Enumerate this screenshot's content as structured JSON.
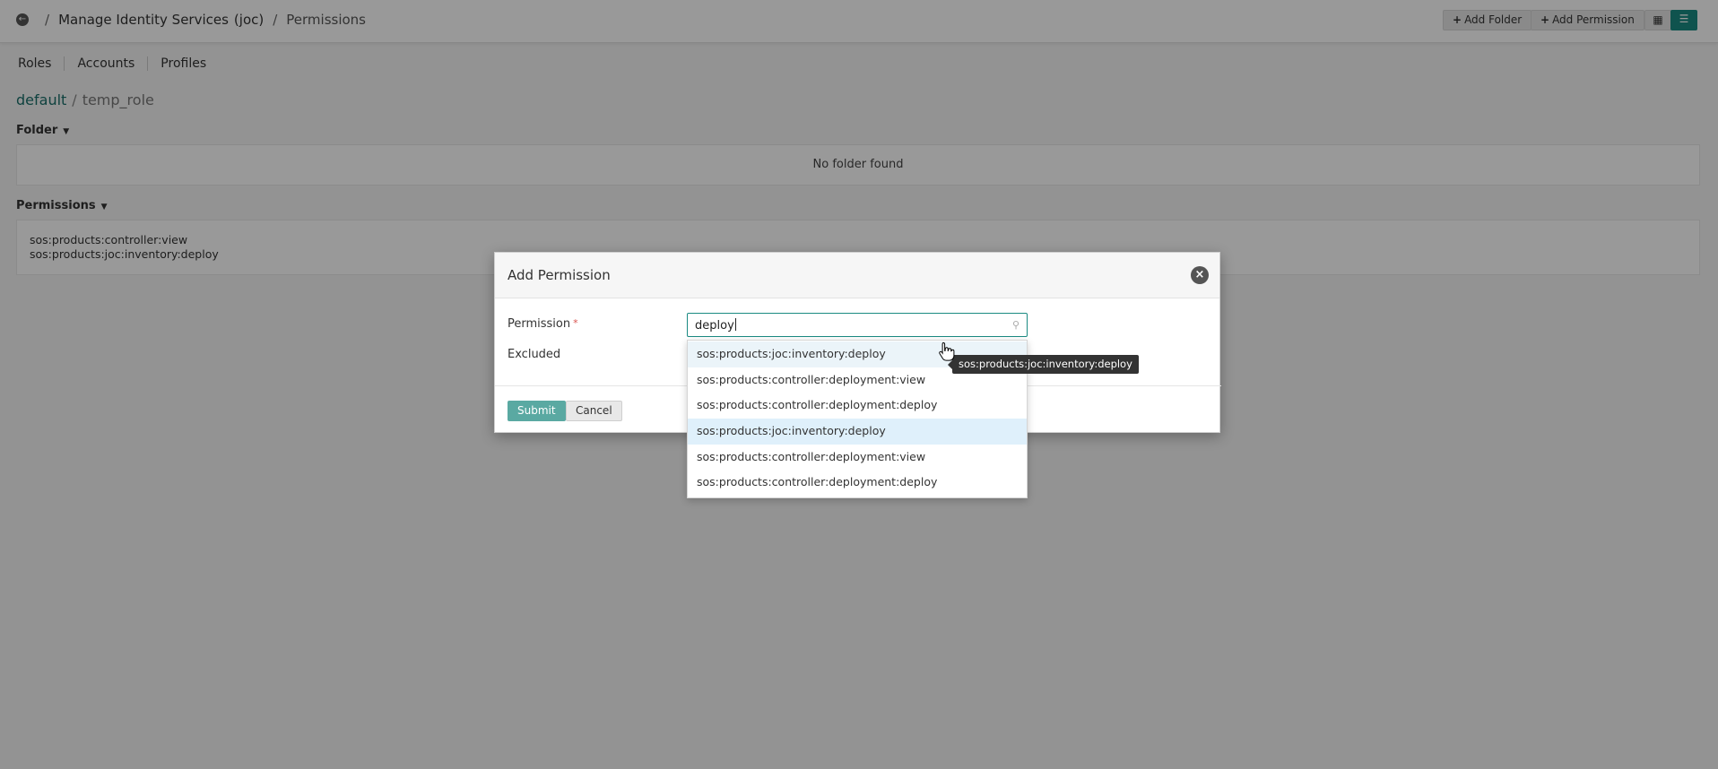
{
  "header": {
    "breadcrumb": [
      "Manage Identity Services",
      "(joc)",
      "Permissions"
    ],
    "sep": "/",
    "buttons": {
      "add_folder": "Add Folder",
      "add_permission": "Add Permission"
    }
  },
  "tabs": [
    "Roles",
    "Accounts",
    "Profiles"
  ],
  "path": {
    "root": "default",
    "sep": "/",
    "leaf": "temp_role"
  },
  "folder_section": {
    "title": "Folder",
    "empty_text": "No folder found"
  },
  "permissions_section": {
    "title": "Permissions",
    "items": [
      "sos:products:controller:view",
      "sos:products:joc:inventory:deploy"
    ]
  },
  "modal": {
    "title": "Add Permission",
    "permission_label": "Permission",
    "required_mark": "*",
    "excluded_label": "Excluded",
    "search_value": "deploy",
    "submit_label": "Submit",
    "cancel_label": "Cancel"
  },
  "dropdown": {
    "options": [
      "sos:products:joc:inventory:deploy",
      "sos:products:controller:deployment:view",
      "sos:products:controller:deployment:deploy",
      "sos:products:joc:inventory:deploy",
      "sos:products:controller:deployment:view",
      "sos:products:controller:deployment:deploy"
    ]
  },
  "tooltip": {
    "text": "sos:products:joc:inventory:deploy"
  },
  "colors": {
    "accent": "#1a8a82",
    "submit": "#5aa9a2",
    "grid_view_active": "#1a8a82"
  },
  "icons": {
    "back": "arrow-left-circle-icon",
    "close": "close-circle-icon",
    "search": "search-icon",
    "grid": "grid-icon",
    "list": "list-icon"
  }
}
